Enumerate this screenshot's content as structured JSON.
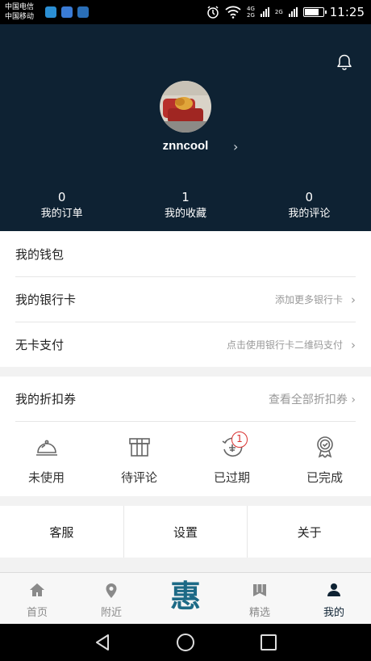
{
  "status_bar": {
    "carrier1": "中国电信",
    "carrier2": "中国移动",
    "net1": "4G",
    "net2": "2G",
    "net3": "2G",
    "time": "11:25",
    "battery_level": 0.7
  },
  "profile": {
    "username": "znncool",
    "stats": [
      {
        "value": "0",
        "label": "我的订单"
      },
      {
        "value": "1",
        "label": "我的收藏"
      },
      {
        "value": "0",
        "label": "我的评论"
      }
    ]
  },
  "wallet": {
    "title": "我的钱包",
    "bank_card": {
      "label": "我的银行卡",
      "hint": "添加更多银行卡"
    },
    "cardless": {
      "label": "无卡支付",
      "hint": "点击使用银行卡二维码支付"
    }
  },
  "coupons": {
    "title": "我的折扣券",
    "view_all": "查看全部折扣券",
    "items": [
      {
        "label": "未使用",
        "icon": "cloche-icon"
      },
      {
        "label": "待评论",
        "icon": "gift-box-icon"
      },
      {
        "label": "已过期",
        "icon": "expired-icon"
      },
      {
        "label": "已完成",
        "icon": "medal-icon"
      }
    ],
    "expired_badge": "1"
  },
  "services": [
    "客服",
    "设置",
    "关于"
  ],
  "tabs": [
    {
      "label": "首页",
      "icon": "home-icon"
    },
    {
      "label": "附近",
      "icon": "location-pin-icon"
    },
    {
      "label": "惠",
      "icon": "hui-logo"
    },
    {
      "label": "精选",
      "icon": "bookmark-icon"
    },
    {
      "label": "我的",
      "icon": "person-icon"
    }
  ],
  "colors": {
    "header_bg": "#0e2233",
    "logo": "#1d6a86",
    "badge": "#d9302e"
  }
}
